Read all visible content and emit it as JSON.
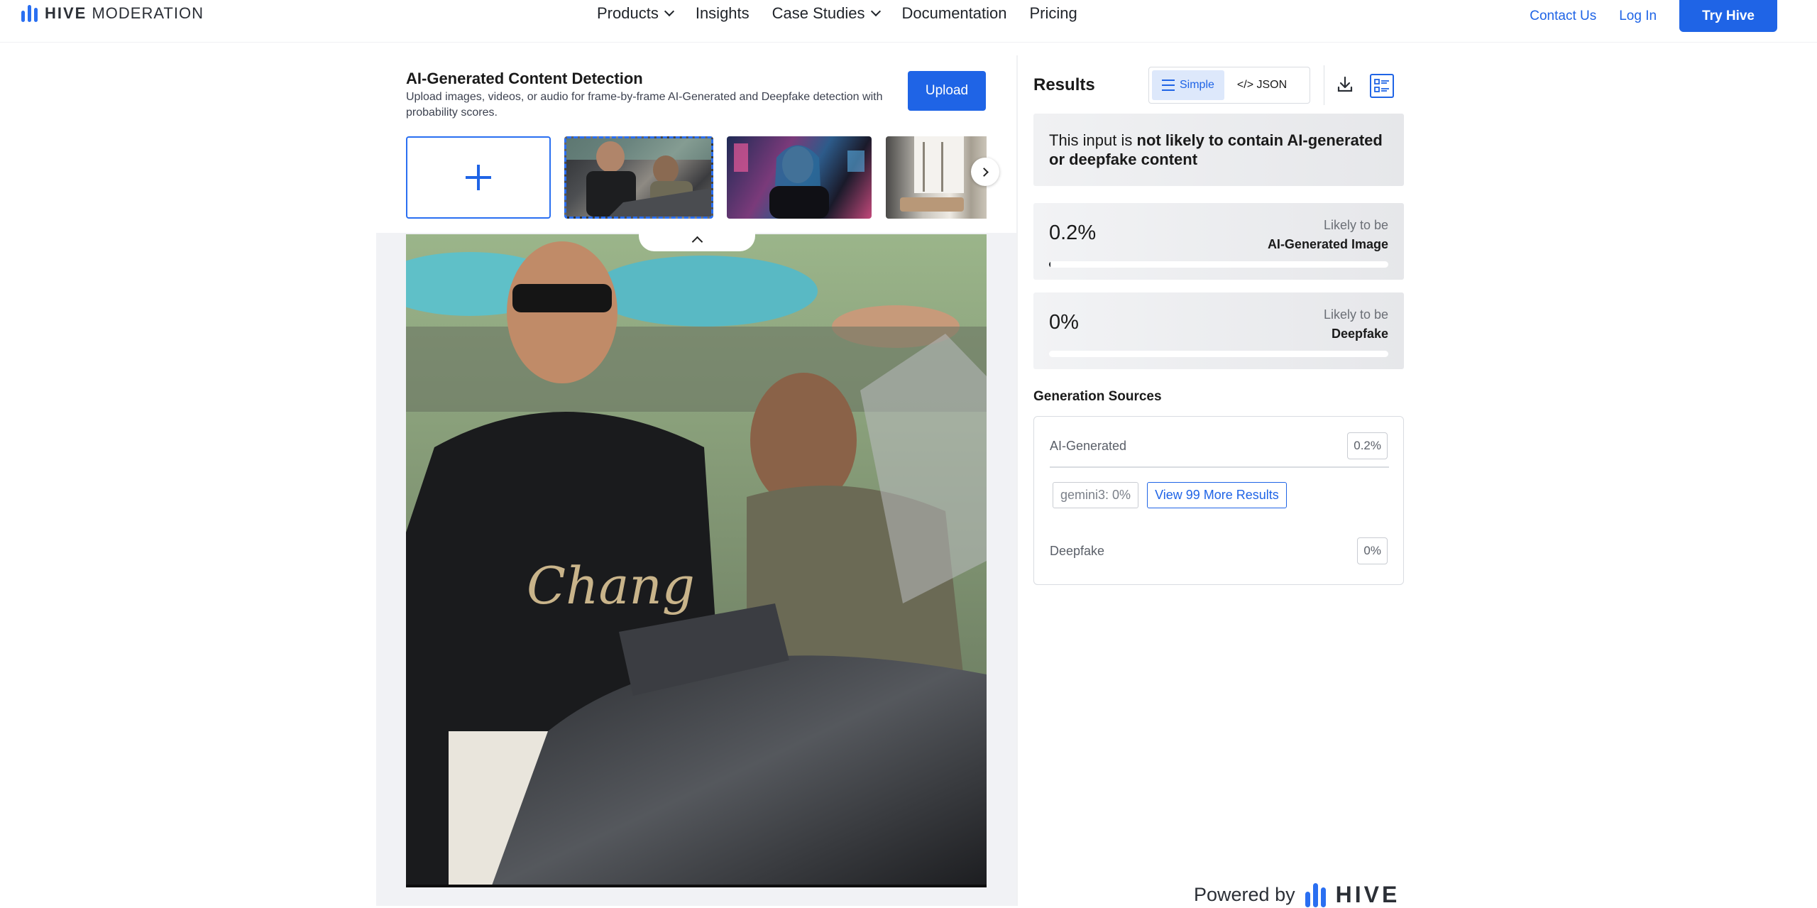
{
  "brand": {
    "name_bold": "HIVE",
    "name_light": "MODERATION",
    "accent": "#1f64e6"
  },
  "nav": {
    "items": [
      {
        "label": "Products",
        "dropdown": true
      },
      {
        "label": "Insights",
        "dropdown": false
      },
      {
        "label": "Case Studies",
        "dropdown": true
      },
      {
        "label": "Documentation",
        "dropdown": false
      },
      {
        "label": "Pricing",
        "dropdown": false
      }
    ],
    "contact_label": "Contact Us",
    "login_label": "Log In",
    "try_label": "Try Hive"
  },
  "detector": {
    "title": "AI-Generated Content Detection",
    "description": "Upload images, videos, or audio for frame-by-frame AI-Generated and Deepfake detection with probability scores.",
    "upload_label": "Upload",
    "thumbnails": [
      "add-new",
      "sample-image-1",
      "sample-image-2",
      "sample-image-3"
    ]
  },
  "results": {
    "title": "Results",
    "view_simple": "Simple",
    "view_json": "</> JSON",
    "verdict_prefix": "This input is ",
    "verdict_bold": "not likely to contain AI-generated or deepfake content",
    "scores": [
      {
        "value": "0.2%",
        "fraction": 0.002,
        "label_top": "Likely to be",
        "label_bottom": "AI-Generated Image"
      },
      {
        "value": "0%",
        "fraction": 0.0,
        "label_top": "Likely to be",
        "label_bottom": "Deepfake"
      }
    ],
    "sources_title": "Generation Sources",
    "sources": {
      "ai_label": "AI-Generated",
      "ai_value": "0.2%",
      "tag_gemini": "gemini3: 0%",
      "more_label": "View 99 More Results",
      "deepfake_label": "Deepfake",
      "deepfake_value": "0%"
    }
  },
  "footer": {
    "powered_by": "Powered by",
    "brand": "HIVE"
  }
}
